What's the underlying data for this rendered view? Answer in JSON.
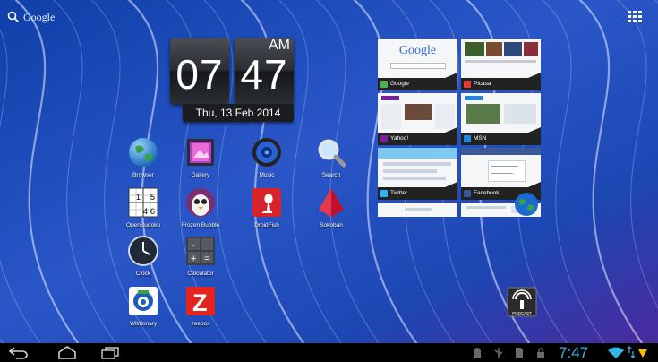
{
  "search": {
    "label": "Google"
  },
  "clock": {
    "hour": "07",
    "minute": "47",
    "ampm": "AM",
    "date": "Thu, 13 Feb 2014"
  },
  "apps": [
    {
      "name": "Browser",
      "icon": "globe-icon"
    },
    {
      "name": "Gallery",
      "icon": "gallery-icon"
    },
    {
      "name": "Music",
      "icon": "speaker-icon"
    },
    {
      "name": "Search",
      "icon": "magnifier-icon"
    },
    {
      "name": "OpenSudoku",
      "icon": "sudoku-icon",
      "glyphs": [
        "1",
        "5",
        "4",
        "6"
      ]
    },
    {
      "name": "Frozen Bubble",
      "icon": "penguin-icon"
    },
    {
      "name": "DroidFish",
      "icon": "chess-icon"
    },
    {
      "name": "Sokoban",
      "icon": "gem-icon"
    },
    {
      "name": "Clock",
      "icon": "analog-clock-icon"
    },
    {
      "name": "Calculator",
      "icon": "calculator-icon",
      "glyphs": [
        "-",
        "=",
        "+"
      ]
    },
    {
      "name": "Wiktionary",
      "icon": "wiktionary-icon"
    },
    {
      "name": "zeebox",
      "icon": "zeebox-icon",
      "glyphs": [
        "Z"
      ]
    }
  ],
  "bookmarks": [
    {
      "label": "Google",
      "color": "#4caf50",
      "thumb_text": "Google"
    },
    {
      "label": "Picasa",
      "color": "#e53935"
    },
    {
      "label": "Yahoo!",
      "color": "#7b1fa2"
    },
    {
      "label": "MSN",
      "color": "#1e88e5"
    },
    {
      "label": "Twitter",
      "color": "#29b6f6"
    },
    {
      "label": "Facebook",
      "color": "#3b5998"
    }
  ],
  "podcast": {
    "label": "PODCAST"
  },
  "navbar": {
    "time": "7:47"
  },
  "colors": {
    "accent": "#33b5e5",
    "navbar": "#000000",
    "wallpaper": "#1a4fb5"
  }
}
